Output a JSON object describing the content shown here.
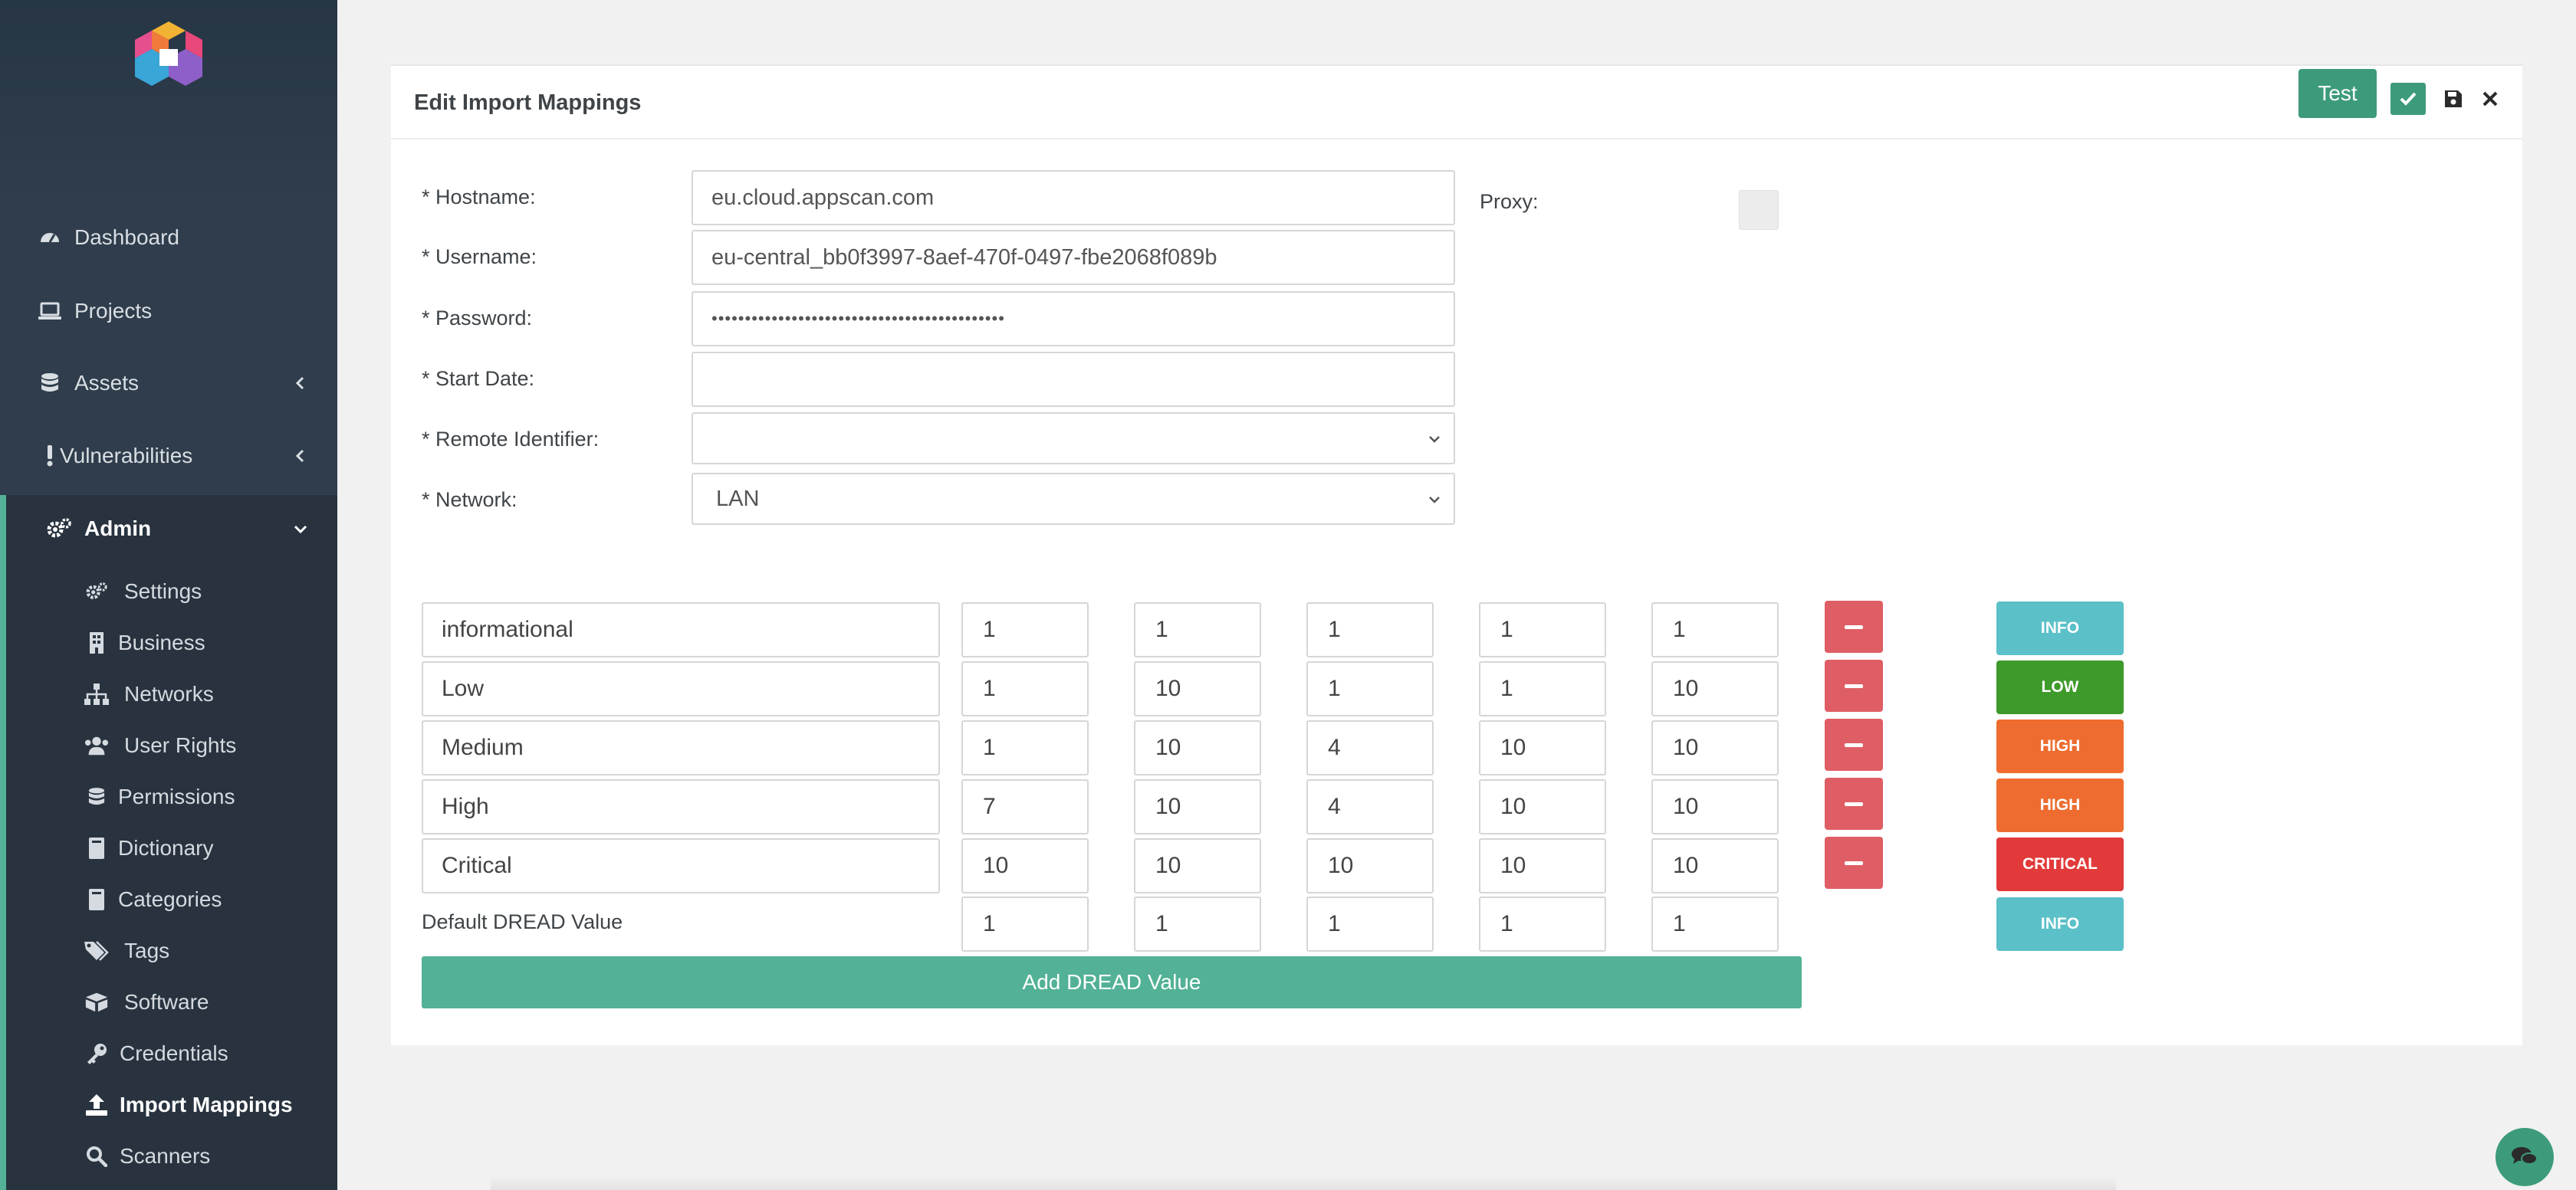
{
  "colors": {
    "sidebar_bg": "#2f3d4c",
    "sidebar_active_bg": "#28333f",
    "accent": "#52b196",
    "primary_button": "#3d9b7c",
    "danger": "#df5e65",
    "info": "#5bc0c8",
    "low": "#3d9a2b",
    "high": "#ee6c2f",
    "critical": "#e23a3a"
  },
  "sidebar": {
    "items": [
      {
        "label": "Dashboard",
        "icon": "dashboard-icon"
      },
      {
        "label": "Projects",
        "icon": "laptop-icon"
      },
      {
        "label": "Assets",
        "icon": "database-icon"
      },
      {
        "label": "Vulnerabilities",
        "icon": "exclamation-icon"
      },
      {
        "label": "Admin",
        "icon": "cogs-icon"
      }
    ],
    "admin_items": [
      {
        "label": "Settings",
        "icon": "cogs-icon"
      },
      {
        "label": "Business",
        "icon": "building-icon"
      },
      {
        "label": "Networks",
        "icon": "sitemap-icon"
      },
      {
        "label": "User Rights",
        "icon": "users-icon"
      },
      {
        "label": "Permissions",
        "icon": "database-icon"
      },
      {
        "label": "Dictionary",
        "icon": "book-icon"
      },
      {
        "label": "Categories",
        "icon": "book-icon"
      },
      {
        "label": "Tags",
        "icon": "tags-icon"
      },
      {
        "label": "Software",
        "icon": "boxes-icon"
      },
      {
        "label": "Credentials",
        "icon": "key-icon"
      },
      {
        "label": "Import Mappings",
        "icon": "upload-icon"
      },
      {
        "label": "Scanners",
        "icon": "search-icon"
      }
    ]
  },
  "panel": {
    "title": "Edit Import Mappings",
    "test_label": "Test"
  },
  "form": {
    "hostname_label": "* Hostname:",
    "hostname_value": "eu.cloud.appscan.com",
    "username_label": "* Username:",
    "username_value": "eu-central_bb0f3997-8aef-470f-0497-fbe2068f089b",
    "password_label": "* Password:",
    "password_value": "••••••••••••••••••••••••••••••••••••••••••••",
    "start_date_label": "* Start Date:",
    "start_date_value": "",
    "remote_identifier_label": "* Remote Identifier:",
    "remote_identifier_value": "",
    "network_label": "* Network:",
    "network_value": "LAN",
    "proxy_label": "Proxy:"
  },
  "dread": {
    "rows": [
      {
        "name": "informational",
        "values": [
          "1",
          "1",
          "1",
          "1",
          "1"
        ],
        "severity": "INFO",
        "severity_color": "#5bc0c8"
      },
      {
        "name": "Low",
        "values": [
          "1",
          "10",
          "1",
          "1",
          "10"
        ],
        "severity": "LOW",
        "severity_color": "#3d9a2b"
      },
      {
        "name": "Medium",
        "values": [
          "1",
          "10",
          "4",
          "10",
          "10"
        ],
        "severity": "HIGH",
        "severity_color": "#ee6c2f"
      },
      {
        "name": "High",
        "values": [
          "7",
          "10",
          "4",
          "10",
          "10"
        ],
        "severity": "HIGH",
        "severity_color": "#ee6c2f"
      },
      {
        "name": "Critical",
        "values": [
          "10",
          "10",
          "10",
          "10",
          "10"
        ],
        "severity": "CRITICAL",
        "severity_color": "#e23a3a"
      }
    ],
    "default_label": "Default DREAD Value",
    "default_values": [
      "1",
      "1",
      "1",
      "1",
      "1"
    ],
    "default_severity": "INFO",
    "add_label": "Add DREAD Value"
  }
}
